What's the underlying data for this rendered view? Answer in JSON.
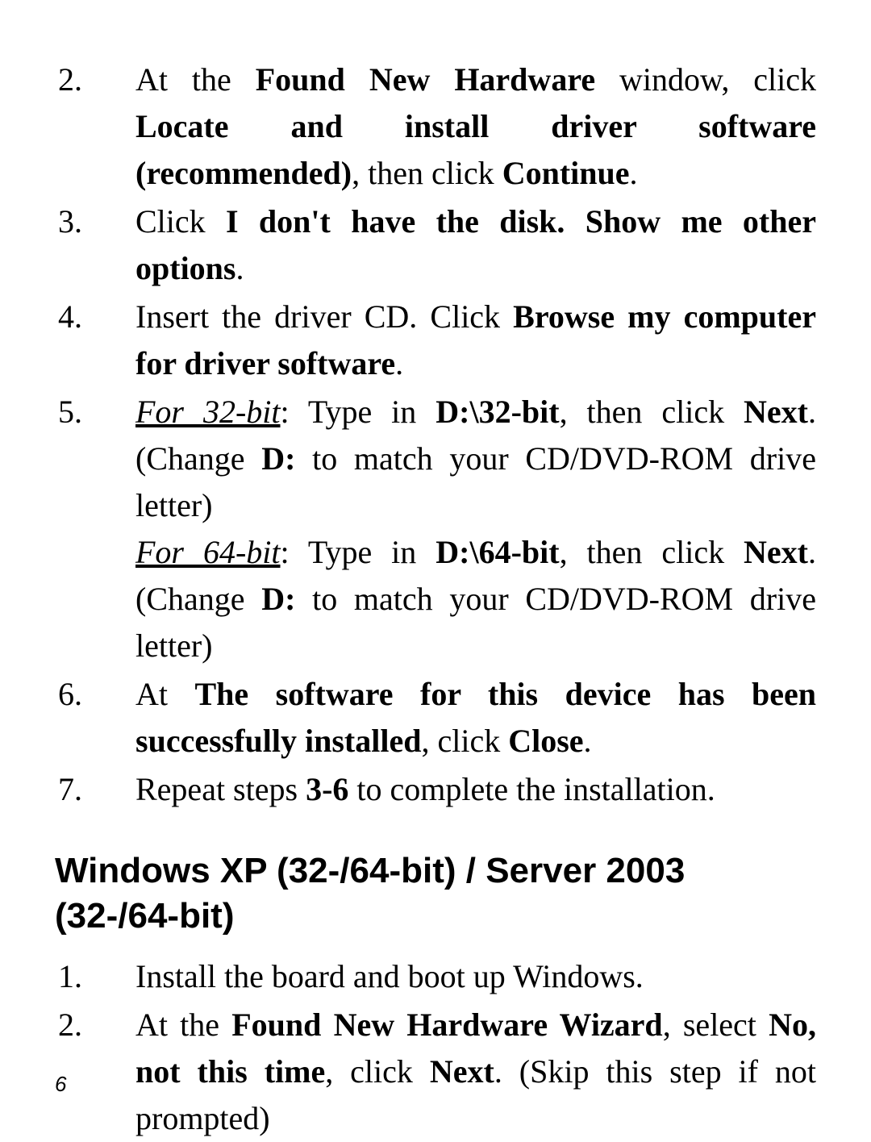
{
  "list1": {
    "2": {
      "num": "2.",
      "t1": "At the ",
      "b1": "Found New Hardware",
      "t2": " window, click ",
      "b2": "Locate and install driver software (recommended)",
      "t3": ", then click ",
      "b3": "Continue",
      "t4": "."
    },
    "3": {
      "num": "3.",
      "t1": "Click ",
      "b1": "I don't have the disk. Show me other options",
      "t2": "."
    },
    "4": {
      "num": "4.",
      "t1": "Insert the driver CD. Click ",
      "b1": "Browse my computer for driver software",
      "t2": "."
    },
    "5": {
      "num": "5.",
      "iu1": "For 32-bit",
      "t1": ": Type in ",
      "b1": "D:\\32-bit",
      "t2": ", then click ",
      "b2": "Next",
      "t3": ". (Change ",
      "b3": "D:",
      "t4": " to match your CD/DVD-ROM drive letter)",
      "iu2": "For 64-bit",
      "t5": ": Type in ",
      "b4": "D:\\64-bit",
      "t6": ", then click ",
      "b5": "Next",
      "t7": ". (Change ",
      "b6": "D:",
      "t8": " to match your CD/DVD-ROM drive letter)"
    },
    "6": {
      "num": "6.",
      "t1": "At ",
      "b1": "The software for this device has been successfully installed",
      "t2": ", click ",
      "b2": "Close",
      "t3": "."
    },
    "7": {
      "num": "7.",
      "t1": "Repeat steps ",
      "b1": "3-6",
      "t2": " to complete the installation."
    }
  },
  "heading": "Windows XP (32-/64-bit) / Server 2003 (32-/64-bit)",
  "list2": {
    "1": {
      "num": "1.",
      "t1": "Install the board and boot up Windows."
    },
    "2": {
      "num": "2.",
      "t1": "At the ",
      "b1": "Found New Hardware Wizard",
      "t2": ", select ",
      "b2": "No, not this time",
      "t3": ", click ",
      "b3": "Next",
      "t4": ".  (Skip this step if not prompted)"
    }
  },
  "page_number": "6"
}
